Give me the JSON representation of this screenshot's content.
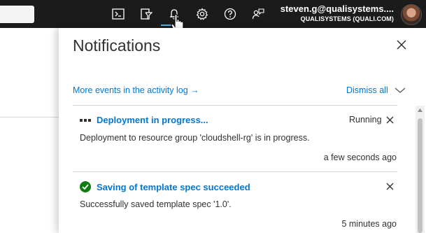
{
  "topbar": {
    "icons": [
      "cloud-shell-icon",
      "directory-filter-icon",
      "notifications-bell-icon",
      "settings-gear-icon",
      "help-icon",
      "feedback-icon"
    ],
    "user_email": "steven.g@qualisystems....",
    "user_tenant": "QUALISYSTEMS (QUALI.COM)"
  },
  "panel": {
    "title": "Notifications",
    "activity_link": "More events in the activity log →",
    "dismiss_all": "Dismiss all",
    "notifications": [
      {
        "title": "Deployment in progress...",
        "status": "Running",
        "description": "Deployment to resource group 'cloudshell-rg' is in progress.",
        "time": "a few seconds ago"
      },
      {
        "title": "Saving of template spec succeeded",
        "status": "",
        "description": "Successfully saved template spec '1.0'.",
        "time": "5 minutes ago"
      }
    ]
  },
  "colors": {
    "topbar_bg": "#1b1b1b",
    "link": "#0078d4",
    "success": "#107c10",
    "active_indicator": "#4fb3e3"
  }
}
